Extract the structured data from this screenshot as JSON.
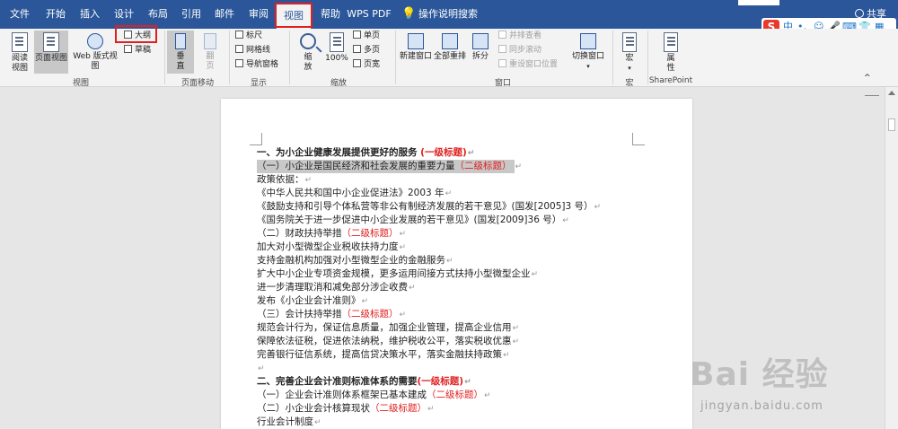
{
  "tabs": [
    {
      "label": "文件",
      "active": false
    },
    {
      "label": "开始",
      "active": false
    },
    {
      "label": "插入",
      "active": false
    },
    {
      "label": "设计",
      "active": false
    },
    {
      "label": "布局",
      "active": false
    },
    {
      "label": "引用",
      "active": false
    },
    {
      "label": "邮件",
      "active": false
    },
    {
      "label": "审阅",
      "active": false
    },
    {
      "label": "视图",
      "active": true
    },
    {
      "label": "帮助",
      "active": false
    },
    {
      "label": "WPS PDF",
      "active": false
    }
  ],
  "tell_me": "操作说明搜索",
  "share": "共享",
  "ime": {
    "s": "S",
    "mode": "中",
    "punct": "•,"
  },
  "ribbon": {
    "views": {
      "read_mode": "阅读\n视图",
      "print_layout": "页面视图",
      "web_layout": "Web 版式视图",
      "outline": "大纲",
      "draft": "草稿",
      "group_label": "视图"
    },
    "page_movement": {
      "vertical": "垂\n直",
      "side_to_side": "翻\n页",
      "group_label": "页面移动"
    },
    "show": {
      "ruler": "标尺",
      "gridlines": "网格线",
      "nav_pane": "导航窗格",
      "group_label": "显示"
    },
    "zoom": {
      "zoom": "缩\n放",
      "hundred": "100%",
      "one_page": "单页",
      "multi_page": "多页",
      "page_width": "页宽",
      "group_label": "缩放"
    },
    "window": {
      "new_window": "新建窗口",
      "arrange_all": "全部重排",
      "split": "拆分",
      "side_by_side": "并排查看",
      "sync_scroll": "同步滚动",
      "reset_pos": "重设窗口位置",
      "switch_windows": "切换窗口",
      "group_label": "窗口"
    },
    "macros": {
      "macros": "宏",
      "group_label": "宏"
    },
    "sharepoint": {
      "properties": "属\n性",
      "group_label": "SharePoint"
    }
  },
  "document": {
    "lines": [
      {
        "text": "一、为小企业健康发展提供更好的服务 ",
        "tag": "(一级标题)",
        "style": "h1"
      },
      {
        "text": "（一）小企业是国民经济和社会发展的重要力量",
        "tag": "（二级标题）",
        "style": "sel"
      },
      {
        "text": "政策依据：",
        "tag": "",
        "style": ""
      },
      {
        "text": "《中华人民共和国中小企业促进法》2003 年",
        "tag": "",
        "style": ""
      },
      {
        "text": "《鼓励支持和引导个体私营等非公有制经济发展的若干意见》(国发[2005]3 号）",
        "tag": "",
        "style": ""
      },
      {
        "text": "《国务院关于进一步促进中小企业发展的若干意见》(国发[2009]36 号）",
        "tag": "",
        "style": ""
      },
      {
        "text": "（二）财政扶持举措",
        "tag": "（二级标题）",
        "style": ""
      },
      {
        "text": "加大对小型微型企业税收扶持力度",
        "tag": "",
        "style": ""
      },
      {
        "text": "支持金融机构加强对小型微型企业的金融服务",
        "tag": "",
        "style": ""
      },
      {
        "text": "扩大中小企业专项资金规模，更多运用间接方式扶持小型微型企业",
        "tag": "",
        "style": ""
      },
      {
        "text": "进一步清理取消和减免部分涉企收费",
        "tag": "",
        "style": ""
      },
      {
        "text": "发布《小企业会计准则》",
        "tag": "",
        "style": ""
      },
      {
        "text": "（三）会计扶持举措",
        "tag": "（二级标题）",
        "style": ""
      },
      {
        "text": "规范会计行为，保证信息质量，加强企业管理，提高企业信用",
        "tag": "",
        "style": ""
      },
      {
        "text": "保障依法征税，促进依法纳税，维护税收公平，落实税收优惠",
        "tag": "",
        "style": ""
      },
      {
        "text": "完善银行征信系统，提高信贷决策水平，落实金融扶持政策",
        "tag": "",
        "style": ""
      },
      {
        "text": "",
        "tag": "",
        "style": ""
      },
      {
        "text": "二、完善企业会计准则标准体系的需要",
        "tag": "(一级标题)",
        "style": "h1"
      },
      {
        "text": "（一）企业会计准则体系框架已基本建成",
        "tag": "（二级标题）",
        "style": ""
      },
      {
        "text": "（二）小企业会计核算现状",
        "tag": "（二级标题）",
        "style": ""
      },
      {
        "text": "行业会计制度",
        "tag": "",
        "style": ""
      }
    ],
    "paragraph_mark": "↵"
  },
  "watermark": {
    "logo": "Bai 经验",
    "url": "jingyan.baidu.com"
  }
}
